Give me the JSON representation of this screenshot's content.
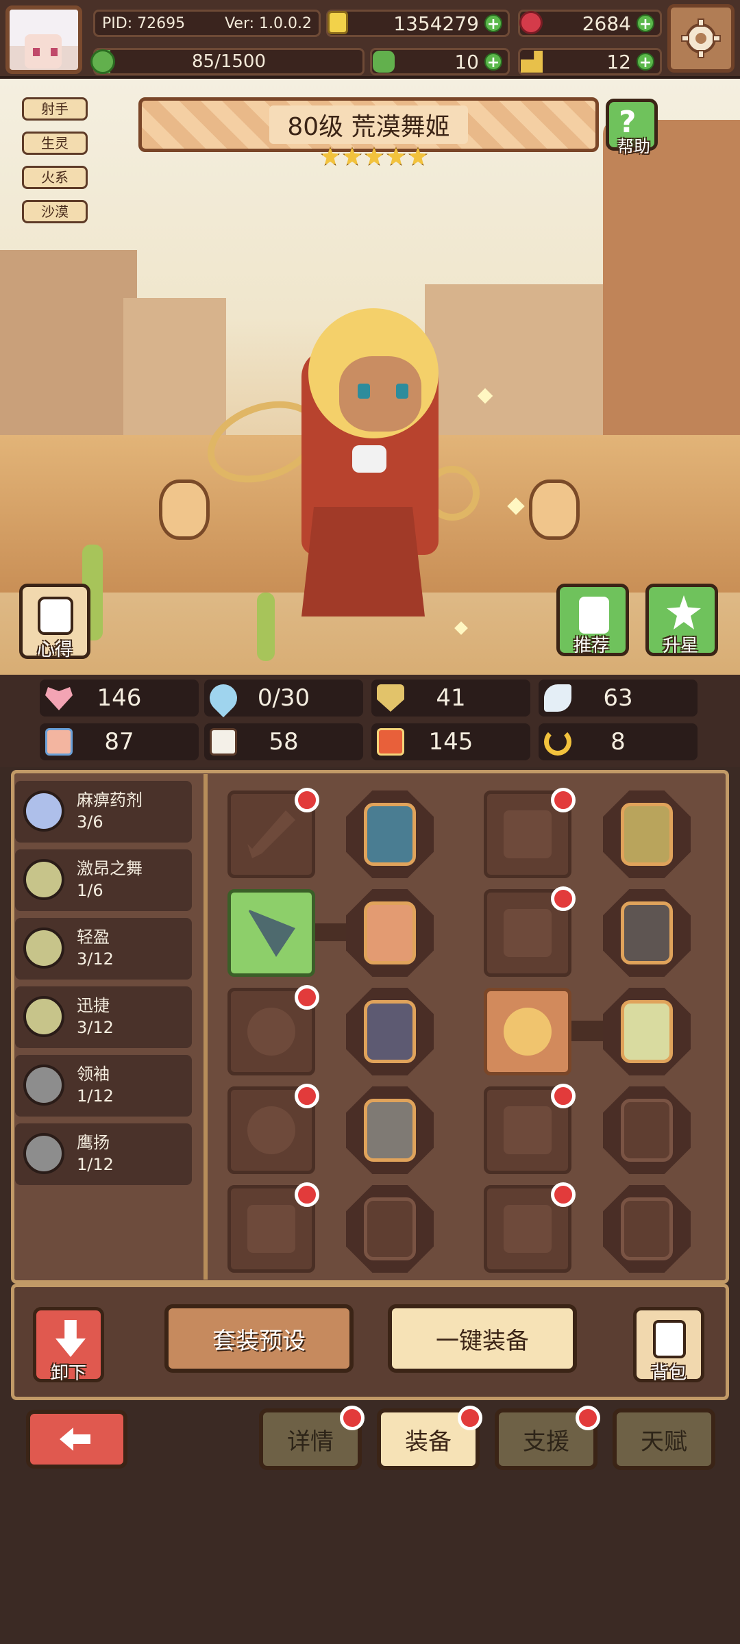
{
  "topbar": {
    "pid": "PID: 72695",
    "version": "Ver: 1.0.0.2",
    "gold": "1354279",
    "gems": "2684",
    "stamina": "85/1500",
    "stamina_fill": 0.0567,
    "clover": "10",
    "key": "12"
  },
  "tags": [
    "射手",
    "生灵",
    "火系",
    "沙漠"
  ],
  "hero": {
    "title": "80级 荒漠舞姬",
    "stars": 5
  },
  "scene_buttons": {
    "help": "帮助",
    "insights": "心得",
    "recommend": "推荐",
    "star_up": "升星"
  },
  "stats": [
    {
      "icon": "heart-icon",
      "value": "146"
    },
    {
      "icon": "water-drop-icon",
      "value": "0/30"
    },
    {
      "icon": "shield-icon",
      "value": "41"
    },
    {
      "icon": "wing-icon",
      "value": "63"
    },
    {
      "icon": "fist-icon",
      "value": "87"
    },
    {
      "icon": "book-icon",
      "value": "58"
    },
    {
      "icon": "crit-icon",
      "value": "145"
    },
    {
      "icon": "horseshoe-icon",
      "value": "8"
    }
  ],
  "set_bonuses": [
    {
      "name": "麻痹药剂",
      "count": "3/6",
      "color": "#aebfea"
    },
    {
      "name": "激昂之舞",
      "count": "1/6",
      "color": "#c7c48a"
    },
    {
      "name": "轻盈",
      "count": "3/12",
      "color": "#c7c48a"
    },
    {
      "name": "迅捷",
      "count": "3/12",
      "color": "#c7c48a"
    },
    {
      "name": "领袖",
      "count": "1/12",
      "color": "#8d8d8d"
    },
    {
      "name": "鹰扬",
      "count": "1/12",
      "color": "#8d8d8d"
    }
  ],
  "actions": {
    "unequip": "卸下",
    "preset": "套装预设",
    "auto_equip": "一键装备",
    "bag": "背包"
  },
  "tabs": [
    "详情",
    "装备",
    "支援",
    "天赋"
  ],
  "colors": {
    "accent_green": "#6fc25c",
    "badge_red": "#e23b3b",
    "panel_brown": "#6d4c3d"
  }
}
